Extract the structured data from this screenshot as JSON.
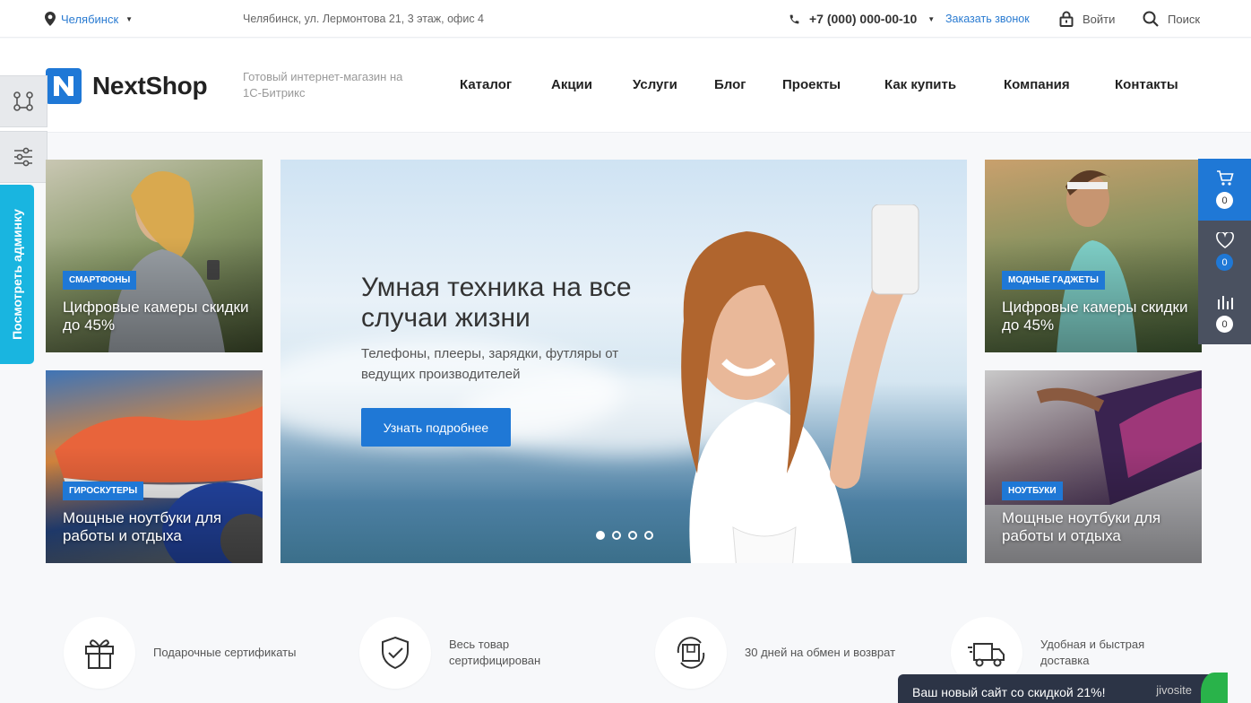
{
  "topbar": {
    "city": "Челябинск",
    "address": "Челябинск, ул. Лермонтова 21, 3 этаж, офис 4",
    "phone": "+7 (000) 000-00-10",
    "callback": "Заказать звонок",
    "login": "Войти",
    "search": "Поиск"
  },
  "header": {
    "logo": "NextShop",
    "tagline": "Готовый интернет-магазин на 1С-Битрикс",
    "nav": [
      "Каталог",
      "Акции",
      "Услуги",
      "Блог",
      "Проекты",
      "Как купить",
      "Компания",
      "Контакты"
    ]
  },
  "admin_tab": "Посмотреть админку",
  "tiles": [
    {
      "badge": "Смартфоны",
      "caption": "Цифровые камеры скидки до 45%"
    },
    {
      "badge": "Гироскутеры",
      "caption": "Мощные ноутбуки для работы и отдыха"
    },
    {
      "badge": "Модные гаджеты",
      "caption": "Цифровые камеры скидки до 45%"
    },
    {
      "badge": "Ноутбуки",
      "caption": "Мощные ноутбуки для работы и отдыха"
    }
  ],
  "hero": {
    "title": "Умная техника на все случаи жизни",
    "subtitle": "Телефоны, плееры, зарядки, футляры от ведущих производителей",
    "button": "Узнать подробнее",
    "slides": 4,
    "active_slide": 1
  },
  "side_panel": {
    "cart_count": "0",
    "favorites_count": "0",
    "compare_count": "0"
  },
  "features": [
    {
      "icon": "gift-icon",
      "text": "Подарочные сертификаты"
    },
    {
      "icon": "shield-check-icon",
      "text": "Весь товар сертифицирован"
    },
    {
      "icon": "box-return-icon",
      "text": "30 дней на обмен и возврат"
    },
    {
      "icon": "truck-icon",
      "text": "Удобная и быстрая доставка"
    }
  ],
  "promo": {
    "text": "Ваш новый сайт со скидкой 21%!",
    "brand": "jivosite"
  },
  "colors": {
    "accent": "#1f78d6",
    "admin_tab": "#19b5e0",
    "panel_dark": "#4a5160",
    "promo_bg": "#2c3446"
  }
}
